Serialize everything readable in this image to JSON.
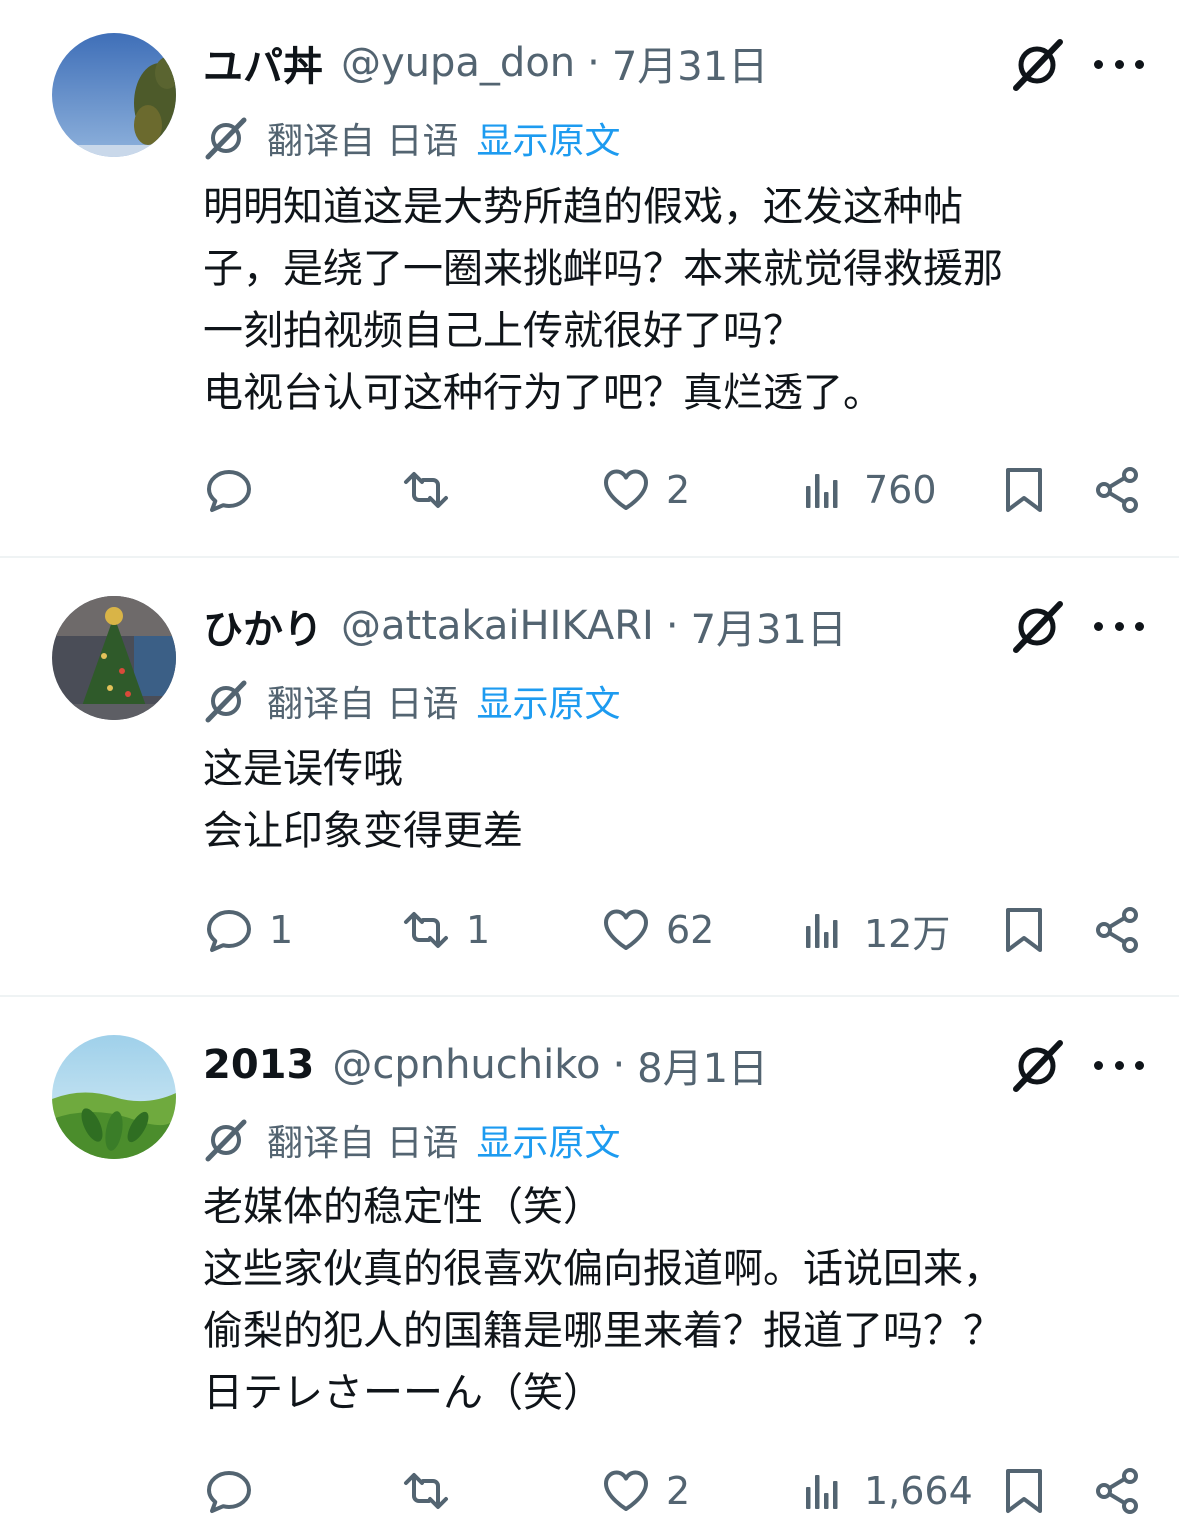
{
  "translation": {
    "label": "翻译自 日语",
    "show_original": "显示原文"
  },
  "tweets": [
    {
      "name": "ユパ丼",
      "handle": "@yupa_don",
      "date": "7月31日",
      "lines": [
        "明明知道这是大势所趋的假戏，还发这种帖",
        "子，是绕了一圈来挑衅吗？本来就觉得救援那",
        "一刻拍视频自己上传就很好了吗？",
        "电视台认可这种行为了吧？真烂透了。"
      ],
      "reply_count": "",
      "retweet_count": "",
      "like_count": "2",
      "view_count": "760"
    },
    {
      "name": "ひかり",
      "handle": "@attakaiHIKARI",
      "date": "7月31日",
      "lines": [
        "这是误传哦",
        "会让印象变得更差"
      ],
      "reply_count": "1",
      "retweet_count": "1",
      "like_count": "62",
      "view_count": "12万"
    },
    {
      "name": "2013",
      "handle": "@cpnhuchiko",
      "date": "8月1日",
      "lines": [
        "老媒体的稳定性（笑）",
        "这些家伙真的很喜欢偏向报道啊。话说回来，",
        "偷梨的犯人的国籍是哪里来着？报道了吗？？",
        "日テレさーーん（笑）"
      ],
      "reply_count": "",
      "retweet_count": "",
      "like_count": "2",
      "view_count": "1,664"
    }
  ],
  "icons": [
    "grok-icon",
    "more-icon",
    "reply-icon",
    "retweet-icon",
    "like-icon",
    "views-icon",
    "bookmark-icon",
    "share-icon"
  ],
  "colors": {
    "text": "#0f1419",
    "secondary": "#536471",
    "link": "#1d9bf0",
    "divider": "#eff3f4"
  }
}
